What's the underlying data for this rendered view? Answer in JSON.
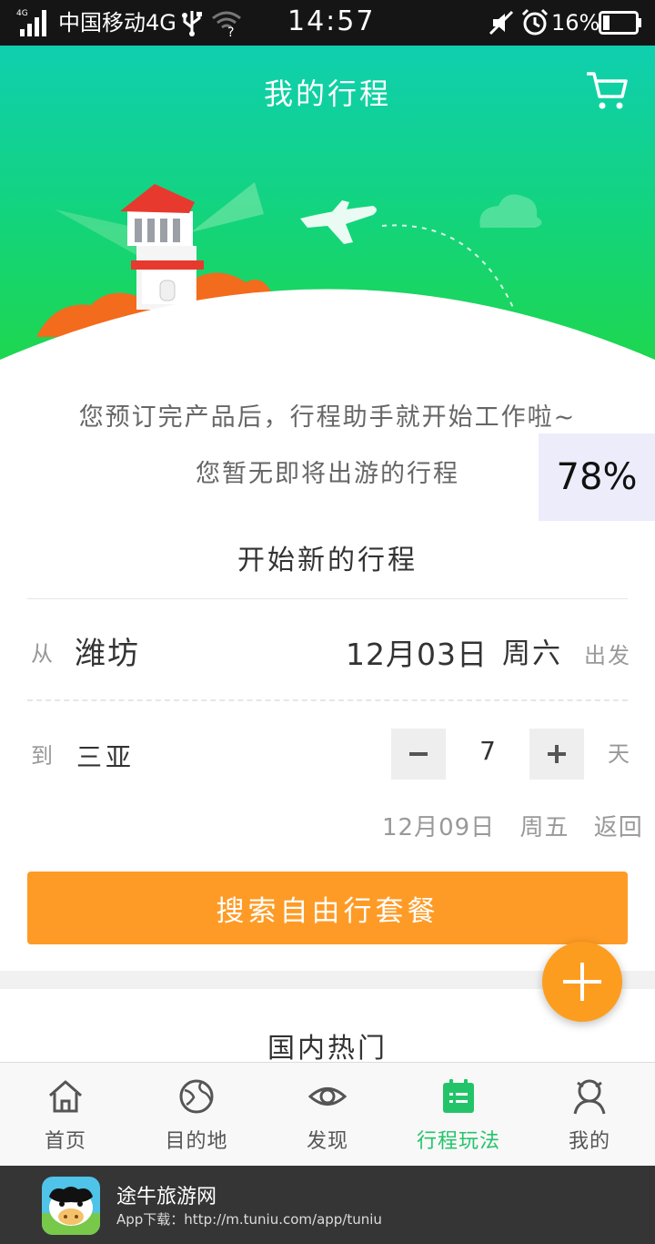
{
  "status_bar": {
    "network_badge": "4G",
    "carrier": "中国移动4G",
    "time": "14:57",
    "battery": "16%"
  },
  "header": {
    "title": "我的行程"
  },
  "empty_state": {
    "line1": "您预订完产品后，行程助手就开始工作啦~",
    "line2": "您暂无即将出游的行程"
  },
  "progress_badge": "78%",
  "planner": {
    "title": "开始新的行程",
    "from_label": "从",
    "from_city": "潍坊",
    "depart_date": "12月03日",
    "depart_weekday": "周六",
    "depart_label": "出发",
    "to_label": "到",
    "to_city": "三亚",
    "days": "7",
    "days_label": "天",
    "return_date": "12月09日",
    "return_weekday": "周五",
    "return_label": "返回",
    "search_button": "搜索自由行套餐"
  },
  "domestic_section_title": "国内热门",
  "tabs": [
    {
      "label": "首页",
      "icon": "home-icon"
    },
    {
      "label": "目的地",
      "icon": "globe-icon"
    },
    {
      "label": "发现",
      "icon": "eye-icon"
    },
    {
      "label": "行程玩法",
      "icon": "calendar-icon",
      "active": true
    },
    {
      "label": "我的",
      "icon": "user-icon"
    }
  ],
  "download_banner": {
    "app_name": "途牛旅游网",
    "download_text": "App下载：http://m.tuniu.com/app/tuniu"
  },
  "colors": {
    "header_top": "#0fcfb0",
    "header_bottom": "#1ed64e",
    "accent_orange": "#fe9b26",
    "active_tab": "#23c469",
    "banner_bg": "#353535"
  }
}
